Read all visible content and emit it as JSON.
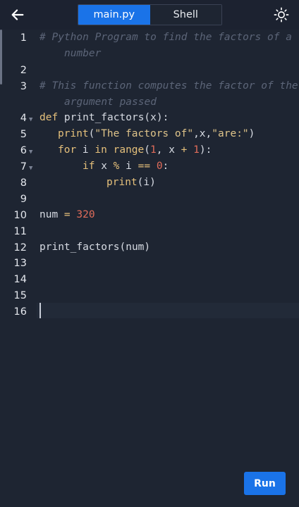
{
  "header": {
    "tabs": [
      {
        "label": "main.py",
        "active": true
      },
      {
        "label": "Shell",
        "active": false
      }
    ],
    "back_icon": "arrow-left-icon",
    "theme_icon": "sun-icon"
  },
  "editor": {
    "line_numbers": [
      "1",
      "2",
      "3",
      "4",
      "5",
      "6",
      "7",
      "8",
      "9",
      "10",
      "11",
      "12",
      "13",
      "14",
      "15",
      "16"
    ],
    "lines": {
      "l1a": "# Python Program to find the factors of a",
      "l1b": "number",
      "l3a": "# This function computes the factor of the",
      "l3b": "argument passed",
      "l4_kw": "def",
      "l4_rest": " print_factors(x):",
      "l5_fn": "print",
      "l5_p1": "(",
      "l5_s1": "\"The factors of\"",
      "l5_p2": ",x,",
      "l5_s2": "\"are:\"",
      "l5_p3": ")",
      "l6_kw1": "for",
      "l6_mid": " i ",
      "l6_kw2": "in",
      "l6_sp": " ",
      "l6_fn": "range",
      "l6_p1": "(",
      "l6_n1": "1",
      "l6_p2": ", x ",
      "l6_op": "+",
      "l6_p3": " ",
      "l6_n2": "1",
      "l6_p4": "):",
      "l7_kw": "if",
      "l7_a": " x ",
      "l7_op1": "%",
      "l7_b": " i ",
      "l7_op2": "==",
      "l7_c": " ",
      "l7_n": "0",
      "l7_d": ":",
      "l8_fn": "print",
      "l8_rest": "(i)",
      "l10_a": "num ",
      "l10_op": "=",
      "l10_b": " ",
      "l10_n": "320",
      "l12": "print_factors(num)"
    },
    "colors": {
      "background": "#1e2532",
      "keyword": "#e5c07b",
      "number": "#e06c5a",
      "comment": "#5c6578",
      "accent": "#1a73e8"
    }
  },
  "run_label": "Run"
}
